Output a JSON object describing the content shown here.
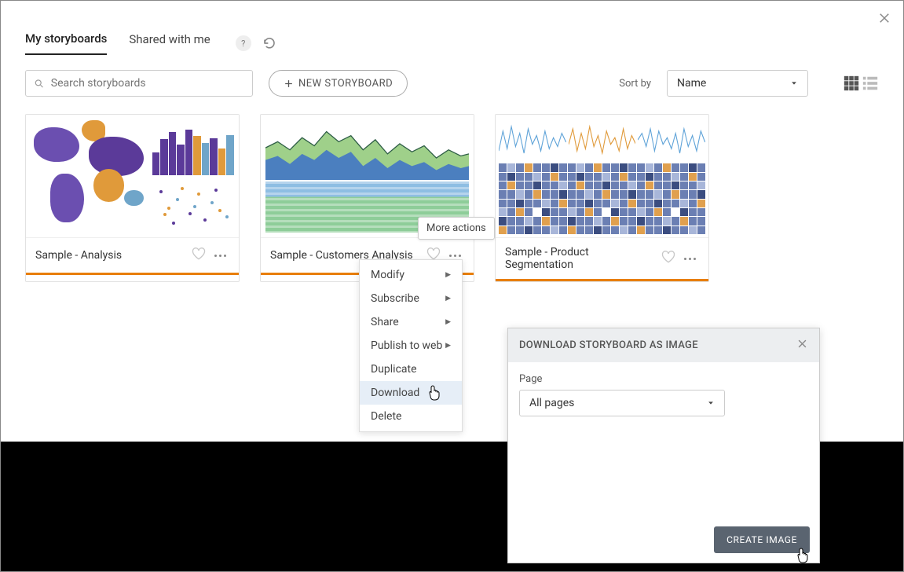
{
  "tabs": {
    "my": "My storyboards",
    "shared": "Shared with me",
    "help_glyph": "?"
  },
  "toolbar": {
    "search_placeholder": "Search storyboards",
    "new_label": "NEW STORYBOARD",
    "sort_label": "Sort by",
    "sort_value": "Name"
  },
  "cards": [
    {
      "title": "Sample - Analysis"
    },
    {
      "title": "Sample - Customers Analysis"
    },
    {
      "title": "Sample - Product Segmentation"
    }
  ],
  "tooltip": "More actions",
  "menu": {
    "modify": "Modify",
    "subscribe": "Subscribe",
    "share": "Share",
    "publish": "Publish to web",
    "duplicate": "Duplicate",
    "download": "Download",
    "delete": "Delete"
  },
  "modal": {
    "title": "DOWNLOAD STORYBOARD AS IMAGE",
    "page_label": "Page",
    "page_value": "All pages",
    "create": "CREATE IMAGE"
  }
}
